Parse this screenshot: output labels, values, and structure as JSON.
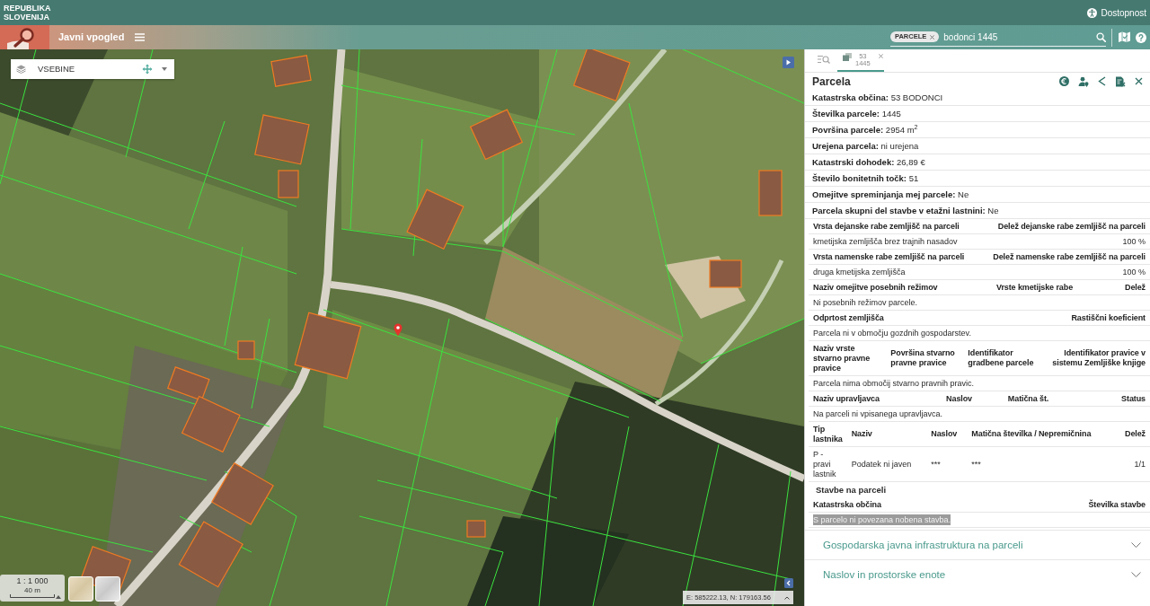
{
  "top_bar": {
    "title": "REPUBLIKA SLOVENIJA",
    "accessibility_link": "Dostopnost"
  },
  "app_bar": {
    "title": "Javni vpogled",
    "search": {
      "filter_chip": "PARCELE",
      "value": "bodonci 1445"
    }
  },
  "map": {
    "layers_menu": {
      "label": "VSEBINE"
    },
    "scale": {
      "ratio": "1 : 1 000",
      "distance": "40 m"
    },
    "coordinates": "E: 585222.13, N: 179163.56"
  },
  "panel": {
    "tabs": [
      {
        "kind": "search",
        "selected": false
      },
      {
        "kind": "parcel",
        "lines": [
          "53",
          "1445"
        ],
        "selected": true
      }
    ],
    "title": "Parcela",
    "properties": [
      {
        "label": "Katastrska občina:",
        "value": "53 BODONCI"
      },
      {
        "label": "Številka parcele:",
        "value": "1445"
      },
      {
        "label": "Površina parcele:",
        "value": "2954 m$^{2}$"
      },
      {
        "label": "Urejena parcela:",
        "value": "ni urejena"
      },
      {
        "label": "Katastrski dohodek:",
        "value": "26,89 €"
      },
      {
        "label": "Število bonitetnih točk:",
        "value": "51"
      },
      {
        "label": "Omejitve spreminjanja mej parcele:",
        "value": "Ne"
      },
      {
        "label": "Parcela skupni del stavbe v etažni lastnini:",
        "value": "Ne"
      }
    ],
    "tables": [
      {
        "columns": [
          "Vrsta dejanske rabe zemljišč na parceli",
          "Delež dejanske rabe zemljišč na parceli"
        ],
        "rows": [
          [
            "kmetijska zemljišča brez trajnih nasadov",
            "100 %"
          ]
        ]
      },
      {
        "columns": [
          "Vrsta namenske rabe zemljišč na parceli",
          "Delež namenske rabe zemljišč na parceli"
        ],
        "rows": [
          [
            "druga kmetijska zemljišča",
            "100 %"
          ]
        ]
      },
      {
        "columns": [
          "Naziv omejitve posebnih režimov",
          "Vrste kmetijske rabe",
          "Delež"
        ],
        "empty": {
          "text": "Ni posebnih režimov parcele.",
          "highlighted": false
        }
      },
      {
        "columns": [
          "Odprtost zemljišča",
          "Rastiščni koeficient"
        ],
        "empty": {
          "text": "Parcela ni v območju gozdnih gospodarstev.",
          "highlighted": false
        }
      },
      {
        "columns": [
          "Naziv vrste stvarno pravne pravice",
          "Površina stvarno pravne pravice",
          "Identifikator gradbene parcele",
          "Identifikator pravice v sistemu Zemljiške knjige"
        ],
        "empty": {
          "text": "Parcela nima območij stvarno pravnih pravic.",
          "highlighted": false
        }
      },
      {
        "columns": [
          "Naziv upravljavca",
          "Naslov",
          "Matična št.",
          "Status"
        ],
        "empty": {
          "text": "Na parceli ni vpisanega upravljavca.",
          "highlighted": false
        }
      },
      {
        "columns": [
          "Tip lastnika",
          "Naziv",
          "Naslov",
          "Matična številka / Nepremičnina",
          "Delež"
        ],
        "rows": [
          [
            "P - pravi lastnik",
            "Podatek ni javen",
            "***",
            "***",
            "1/1"
          ]
        ]
      },
      {
        "title": "Stavbe na parceli",
        "columns": [
          "Katastrska občina",
          "Številka stavbe"
        ],
        "empty": {
          "text": "S parcelo ni povezana nobena stavba.",
          "highlighted": true
        }
      }
    ],
    "accordions": [
      {
        "title": "Gospodarska javna infrastruktura na parceli",
        "expanded": false
      },
      {
        "title": "Naslov in prostorske enote",
        "expanded": false
      }
    ]
  }
}
